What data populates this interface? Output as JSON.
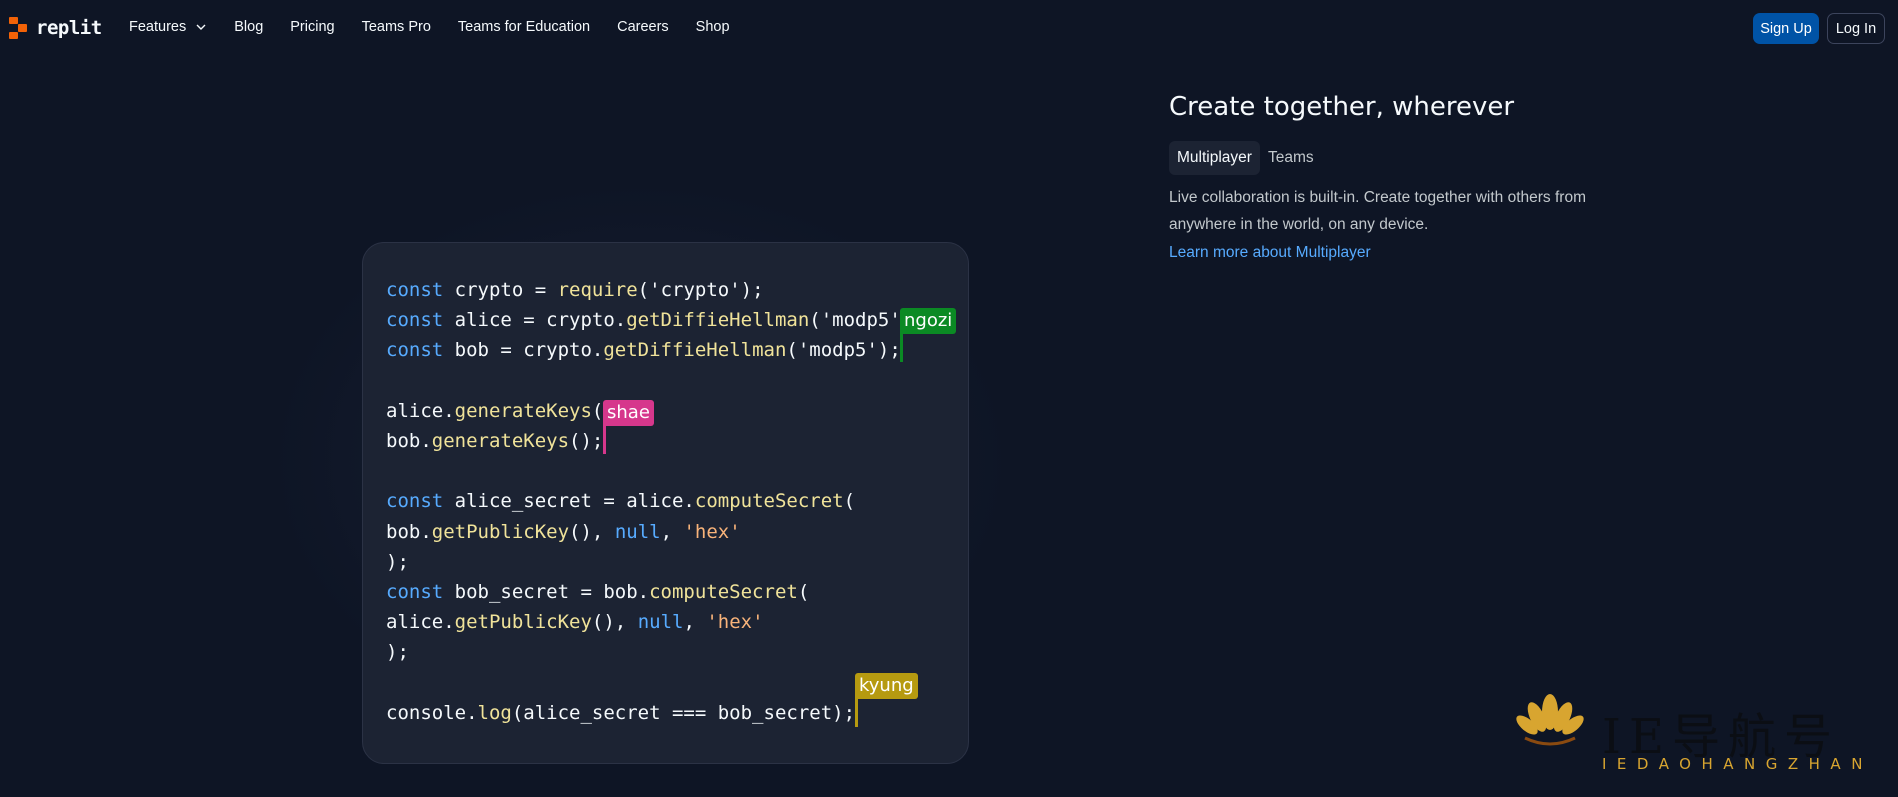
{
  "nav": {
    "logo_text": "replit",
    "links": [
      "Features",
      "Blog",
      "Pricing",
      "Teams Pro",
      "Teams for Education",
      "Careers",
      "Shop"
    ],
    "signup": "Sign Up",
    "login": "Log In"
  },
  "hero": {
    "title": "Create together, wherever",
    "tabs": [
      "Multiplayer",
      "Teams"
    ],
    "active_tab": "Multiplayer",
    "description": "Live collaboration is built-in. Create together with others from anywhere in the world, on any device.",
    "link": "Learn more about Multiplayer"
  },
  "code": {
    "lines": [
      "const crypto = require('crypto');",
      "const alice = crypto.getDiffieHellman('modp5'",
      "const bob = crypto.getDiffieHellman('modp5');",
      "",
      "alice.generateKeys(",
      "bob.generateKeys();",
      "",
      "const alice_secret = alice.computeSecret(",
      "bob.getPublicKey(), null, 'hex'",
      ");",
      "const bob_secret = bob.computeSecret(",
      "alice.getPublicKey(), null, 'hex'",
      ");",
      "",
      "console.log(alice_secret === bob_secret);"
    ]
  },
  "cursors": [
    {
      "name": "ngozi",
      "color": "#0b8a24"
    },
    {
      "name": "shae",
      "color": "#d6378c"
    },
    {
      "name": "kyung",
      "color": "#b69a10"
    }
  ],
  "watermark": {
    "text": "IEDAOHANGZHAN",
    "chars": "IE导航号"
  },
  "colors": {
    "background": "#0e1525",
    "accent": "#0053a6",
    "link": "#57abff",
    "logo": "#f26207"
  }
}
